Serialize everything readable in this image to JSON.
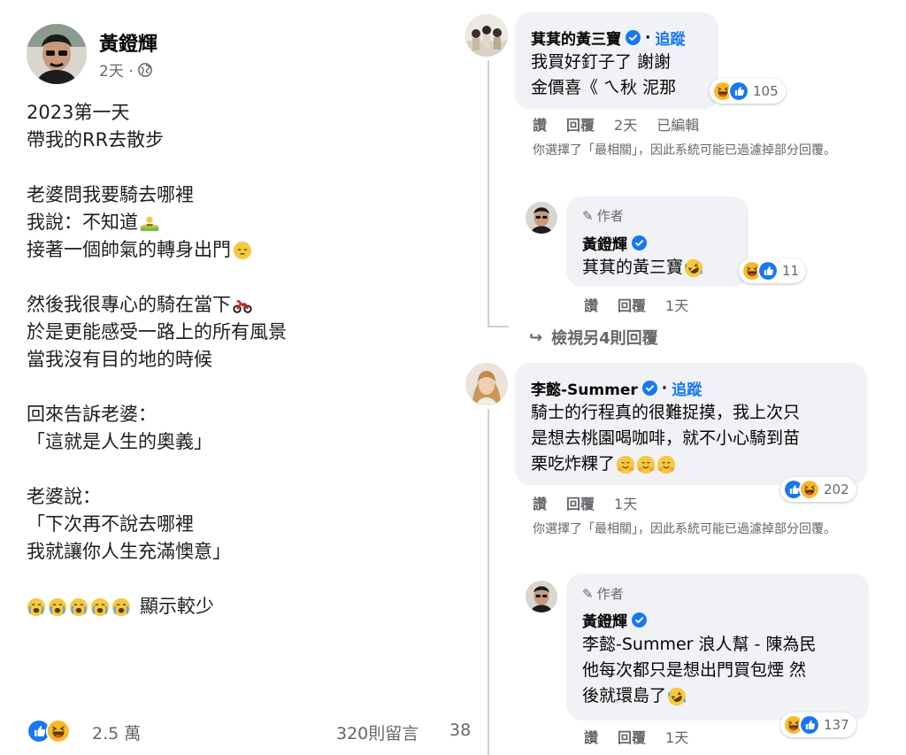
{
  "post": {
    "author": "黃鐙輝",
    "time": "2天 ·",
    "lines": [
      "2023第一天",
      "帶我的RR去散步",
      "",
      "老婆問我要騎去哪裡",
      "我說：不知道",
      "接著一個帥氣的轉身出門",
      "",
      "然後我很專心的騎在當下",
      "於是更能感受一路上的所有風景",
      "當我沒有目的地的時候",
      "",
      "回來告訴老婆：",
      "「這就是人生的奧義」",
      "",
      "老婆說：",
      "「下次再不說去哪裡",
      "我就讓你人生充滿懊意」"
    ],
    "see_less": "顯示較少",
    "reaction_count": "2.5 萬",
    "comment_count": "320則留言",
    "share_count": "38"
  },
  "comments": [
    {
      "name": "萁萁的黃三寶",
      "follow": "追蹤",
      "lines": [
        "我買好釘子了 謝謝",
        "金價喜《 ㄟ秋 泥那"
      ],
      "reactions": "105",
      "actions": [
        "讚",
        "回覆"
      ],
      "time": "2天",
      "edited": "已編輯",
      "note": "你選擇了「最相關」，因此系統可能已過濾掉部分回覆。",
      "reply": {
        "tag": "作者",
        "name": "黃鐙輝",
        "text": "萁萁的黃三寶",
        "reactions": "11",
        "actions": [
          "讚",
          "回覆"
        ],
        "time": "1天"
      },
      "view_more": "檢視另4則回覆"
    },
    {
      "name": "李懿-Summer",
      "follow": "追蹤",
      "lines": [
        "騎士的行程真的很難捉摸，我上次只",
        "是想去桃園喝咖啡，就不小心騎到苗",
        "栗吃炸粿了"
      ],
      "reactions": "202",
      "actions": [
        "讚",
        "回覆"
      ],
      "time": "1天",
      "note": "你選擇了「最相關」，因此系統可能已過濾掉部分回覆。",
      "reply": {
        "tag": "作者",
        "name": "黃鐙輝",
        "lines": [
          "李懿-Summer 浪人幫 - 陳為民",
          "他每次都只是想出門買包煙 然",
          "後就環島了"
        ],
        "reactions": "137",
        "actions": [
          "讚",
          "回覆"
        ],
        "time": "1天"
      }
    }
  ],
  "colors": {
    "link": "#1877f2",
    "secondary_text": "#65676b",
    "bubble": "#f0f2f5",
    "like": "#1877f2",
    "haha": "#f7b928"
  }
}
